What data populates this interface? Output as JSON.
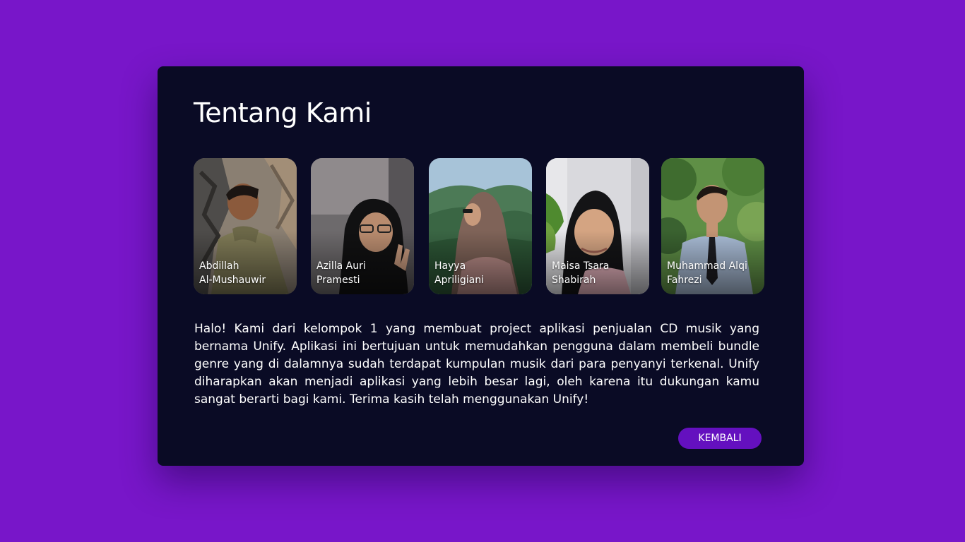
{
  "about": {
    "title": "Tentang Kami",
    "members": [
      {
        "first": "Abdillah",
        "last": "Al-Mushauwir"
      },
      {
        "first": "Azilla Auri",
        "last": "Pramesti"
      },
      {
        "first": "Hayya",
        "last": "Apriligiani"
      },
      {
        "first": "Maisa Tsara",
        "last": "Shabirah"
      },
      {
        "first": "Muhammad Alqi",
        "last": "Fahrezi"
      }
    ],
    "description": "Halo! Kami dari kelompok 1 yang membuat project aplikasi penjualan CD musik yang bernama Unify. Aplikasi ini bertujuan untuk memudahkan pengguna dalam membeli bundle genre yang di dalamnya sudah terdapat kumpulan musik dari para penyanyi terkenal. Unify diharapkan akan menjadi aplikasi yang lebih besar lagi, oleh karena itu dukungan kamu sangat berarti bagi kami. Terima kasih telah menggunakan Unify!",
    "back_button": "KEMBALI"
  },
  "colors": {
    "background": "#7816c9",
    "card": "#0a0b25",
    "button": "#6410bf"
  }
}
